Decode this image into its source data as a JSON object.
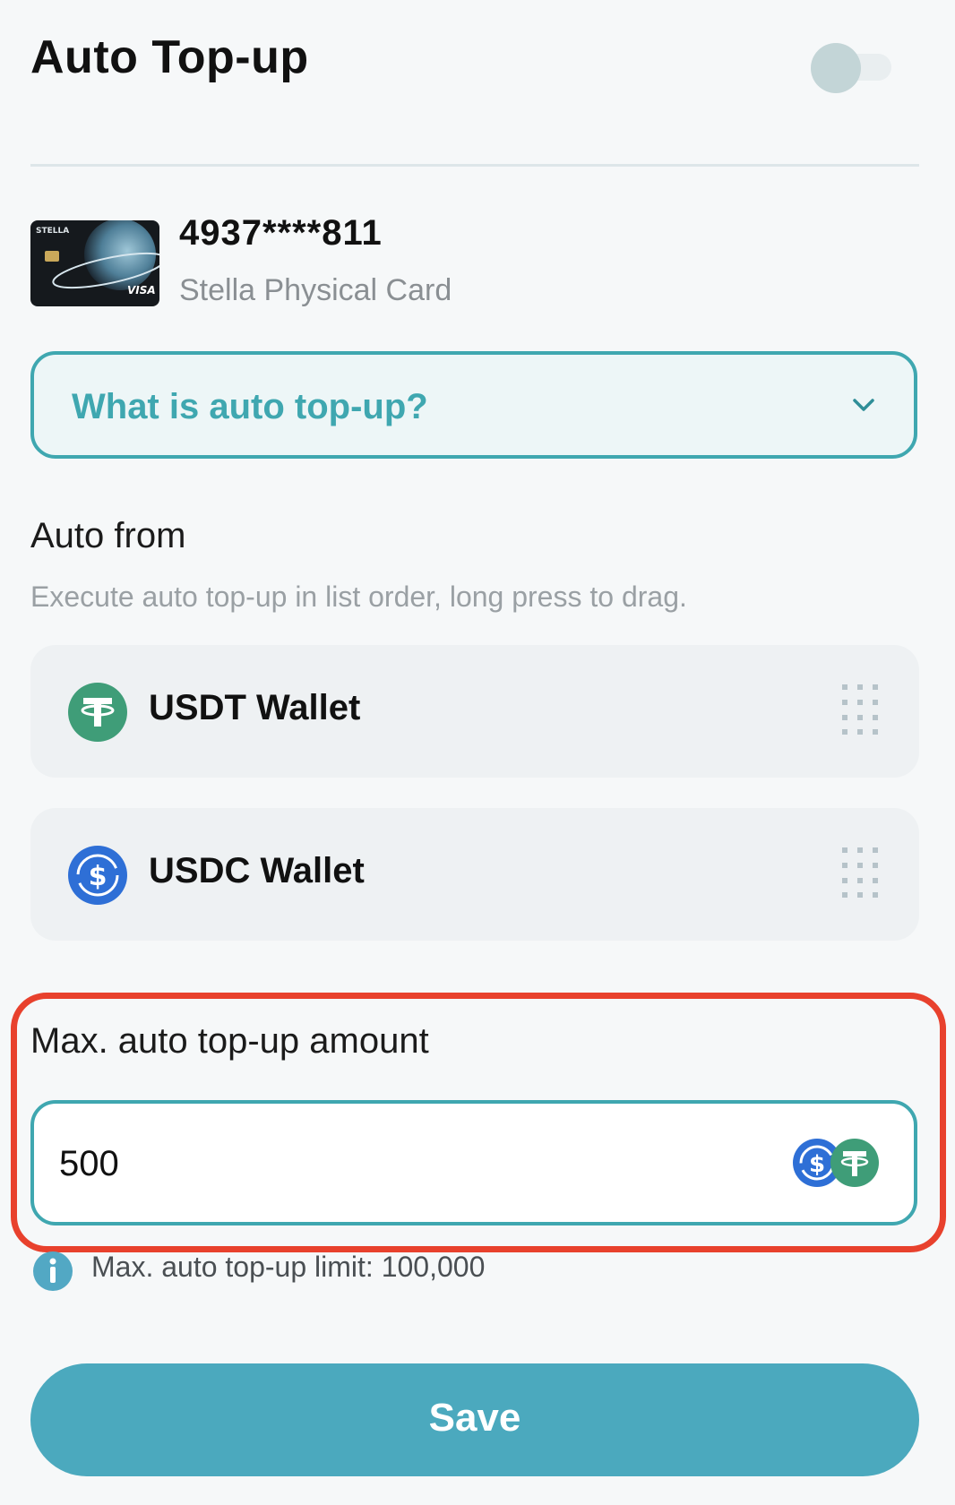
{
  "header": {
    "title": "Auto Top-up",
    "toggle_on": false
  },
  "card": {
    "number": "4937****811",
    "name": "Stella Physical Card",
    "thumb_brand": "STELLA",
    "thumb_network": "VISA"
  },
  "faq": {
    "label": "What is auto top-up?",
    "icon": "chevron-down-icon"
  },
  "auto_from": {
    "title": "Auto from",
    "subtitle": "Execute auto top-up in list order, long press to drag.",
    "wallets": [
      {
        "name": "USDT Wallet",
        "icon": "usdt-icon",
        "color": "#3f9d78"
      },
      {
        "name": "USDC Wallet",
        "icon": "usdc-icon",
        "color": "#2e6fd6"
      }
    ]
  },
  "max_amount": {
    "title": "Max. auto top-up amount",
    "value": "500",
    "limit_text": "Max. auto top-up limit: 100,000"
  },
  "save_button": {
    "label": "Save"
  },
  "colors": {
    "accent": "#3fa7b0",
    "save": "#4ba9be",
    "highlight": "#e8412d",
    "usdt": "#3f9d78",
    "usdc": "#2e6fd6"
  }
}
